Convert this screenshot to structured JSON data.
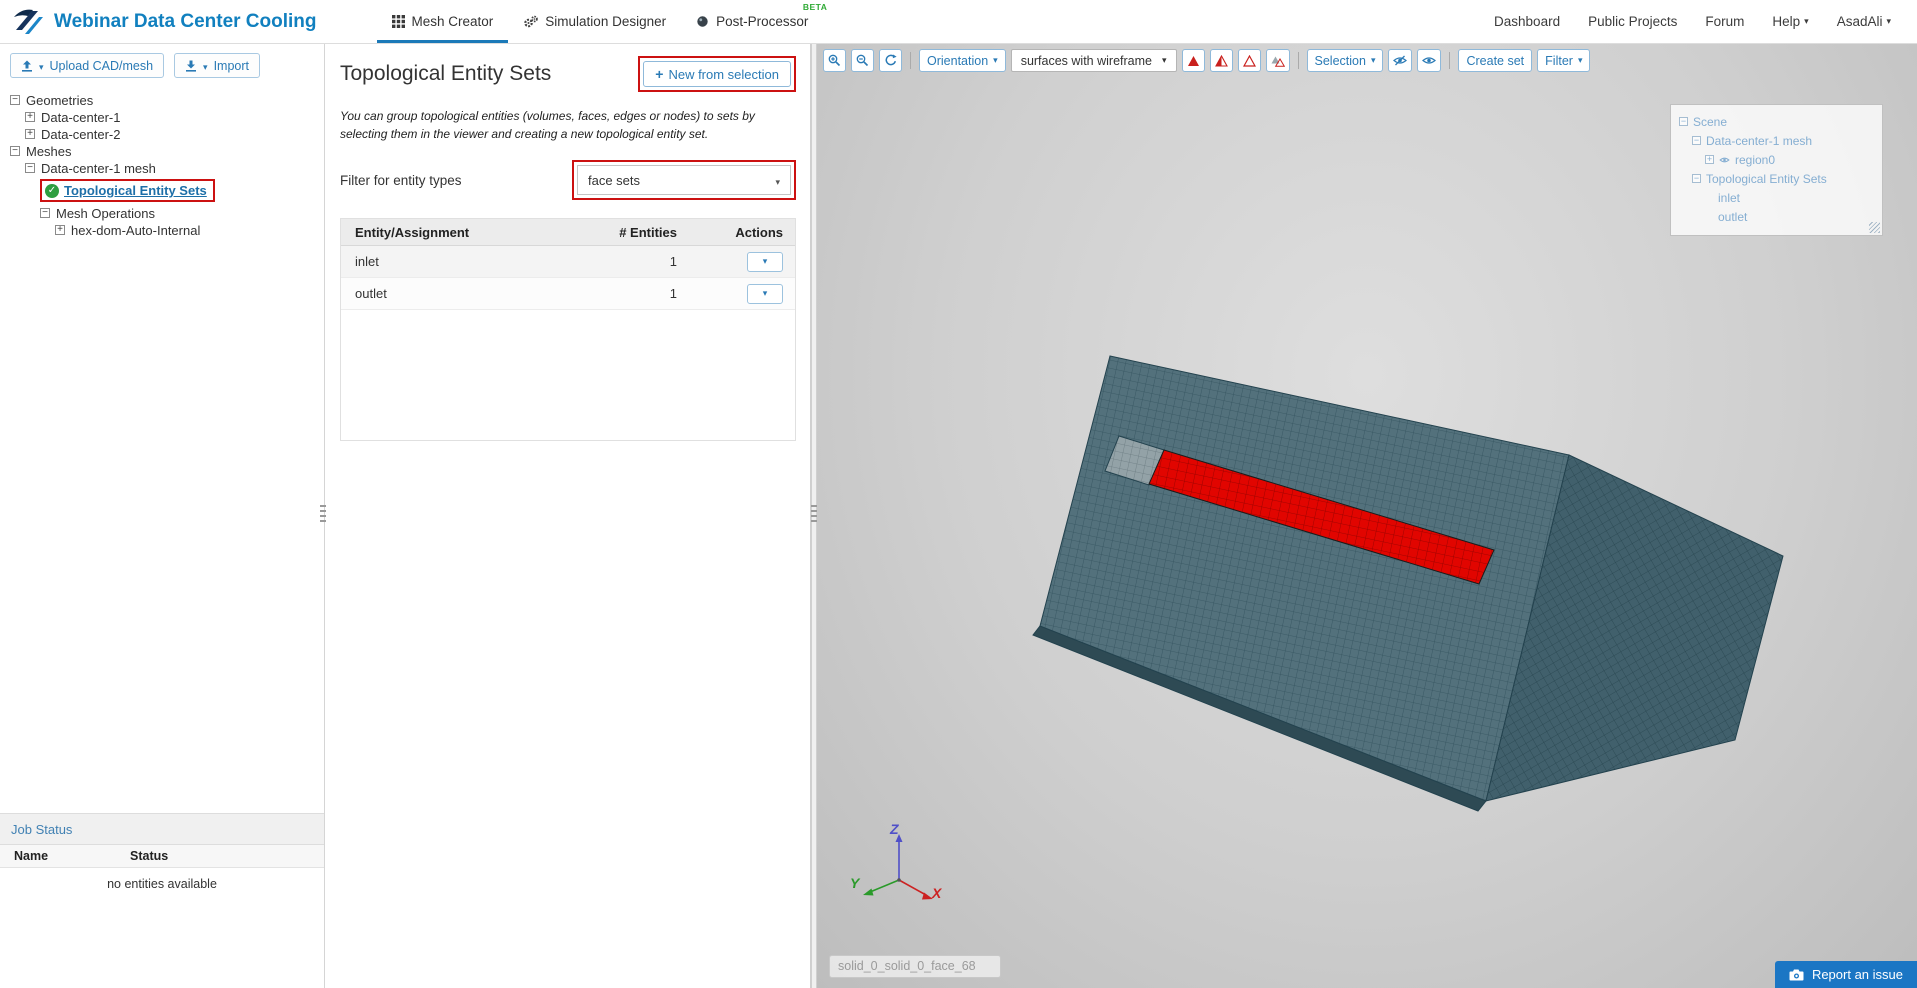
{
  "header": {
    "title": "Webinar Data Center Cooling",
    "tabs": {
      "mesh_creator": "Mesh Creator",
      "simulation_designer": "Simulation Designer",
      "post_processor": "Post-Processor",
      "beta_badge": "BETA"
    },
    "nav": {
      "dashboard": "Dashboard",
      "public_projects": "Public Projects",
      "forum": "Forum",
      "help": "Help",
      "user": "AsadAli"
    }
  },
  "sidebar": {
    "upload_button": "Upload CAD/mesh",
    "import_button": "Import",
    "tree": {
      "geometries": "Geometries",
      "data_center_1": "Data-center-1",
      "data_center_2": "Data-center-2",
      "meshes": "Meshes",
      "data_center_1_mesh": "Data-center-1 mesh",
      "topological_entity_sets": "Topological Entity Sets",
      "mesh_operations": "Mesh Operations",
      "hex_dom": "hex-dom-Auto-Internal"
    },
    "job_status": {
      "title": "Job Status",
      "col_name": "Name",
      "col_status": "Status",
      "empty_text": "no entities available"
    }
  },
  "panel": {
    "title": "Topological Entity Sets",
    "new_from_selection": "New from selection",
    "description": "You can group topological entities (volumes, faces, edges or nodes) to sets by selecting them in the viewer and creating a new topological entity set.",
    "filter_label": "Filter for entity types",
    "filter_value": "face sets",
    "table": {
      "col_entity": "Entity/Assignment",
      "col_entities": "# Entities",
      "col_actions": "Actions",
      "rows": [
        {
          "name": "inlet",
          "count": "1"
        },
        {
          "name": "outlet",
          "count": "1"
        }
      ]
    }
  },
  "viewer": {
    "toolbar": {
      "orientation": "Orientation",
      "render_mode": "surfaces with wireframe",
      "selection": "Selection",
      "create_set": "Create set",
      "filter": "Filter"
    },
    "scene_tree": {
      "scene": "Scene",
      "mesh": "Data-center-1 mesh",
      "region": "region0",
      "topo_sets": "Topological Entity Sets",
      "inlet": "inlet",
      "outlet": "outlet"
    },
    "axis": {
      "x": "X",
      "y": "Y",
      "z": "Z"
    },
    "selection_value": "solid_0_solid_0_face_68",
    "report_issue": "Report an issue"
  },
  "colors": {
    "accent_blue": "#2a7ab5",
    "annotation_red": "#cc1111",
    "selection_red": "#e10500",
    "header_blue": "#1180bf"
  }
}
